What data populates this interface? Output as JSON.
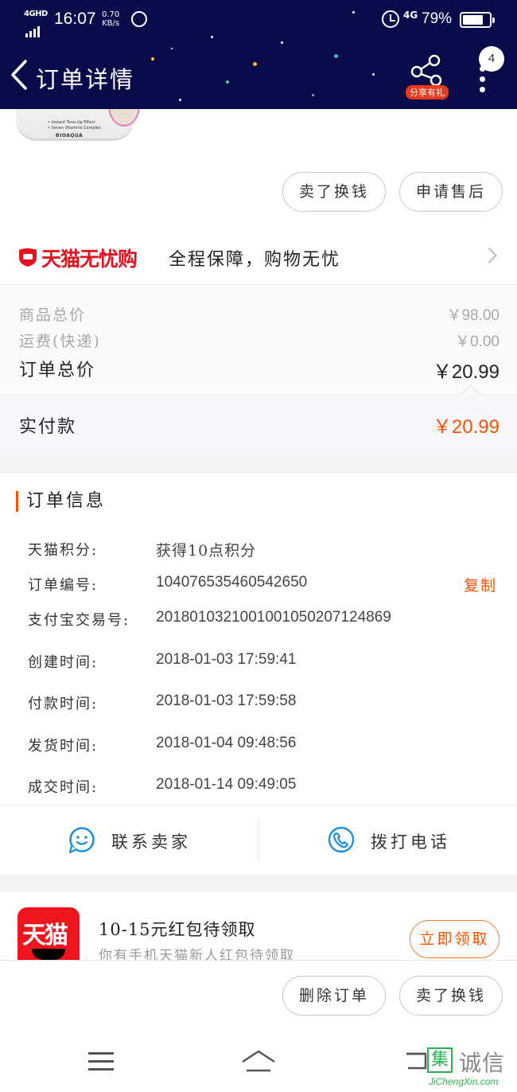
{
  "status_bar": {
    "network": "4GHD",
    "time": "16:07",
    "speed_value": "0.70",
    "speed_unit": "KB/s",
    "network_right": "4G",
    "battery_percent": "79%",
    "battery_level": 0.79
  },
  "nav": {
    "title": "订单详情",
    "share_label": "分享有礼",
    "badge_count": "4"
  },
  "product": {
    "jar_line1": "• Instant Tone-Up Effect",
    "jar_line2": "• Seven Vitamins Complex",
    "jar_brand": "BIOAQUA"
  },
  "actions_top": {
    "sell": "卖了换钱",
    "after_sale": "申请售后"
  },
  "guarantee": {
    "name": "天猫无忧购",
    "slogan": "全程保障，购物无忧"
  },
  "price": {
    "goods_total_label": "商品总价",
    "goods_total_value": "￥98.00",
    "shipping_label": "运费(快递)",
    "shipping_value": "￥0.00",
    "order_total_label": "订单总价",
    "order_total_value": "￥20.99",
    "paid_label": "实付款",
    "paid_value": "￥20.99"
  },
  "order_info": {
    "title": "订单信息",
    "copy_label": "复制",
    "rows": [
      {
        "label": "天猫积分:",
        "value": "获得10点积分"
      },
      {
        "label": "订单编号:",
        "value": "104076535460542650"
      },
      {
        "label": "支付宝交易号:",
        "value": "2018010321001001050207124869"
      },
      {
        "label": "创建时间:",
        "value": "2018-01-03 17:59:41"
      },
      {
        "label": "付款时间:",
        "value": "2018-01-03 17:59:58"
      },
      {
        "label": "发货时间:",
        "value": "2018-01-04 09:48:56"
      },
      {
        "label": "成交时间:",
        "value": "2018-01-14 09:49:05"
      }
    ]
  },
  "contact": {
    "seller": "联系卖家",
    "phone": "拨打电话"
  },
  "promo": {
    "logo_text": "天猫",
    "title": "10-15元红包待领取",
    "subtitle": "你有手机天猫新人红包待领取",
    "button": "立即领取"
  },
  "bottom_actions": {
    "delete": "删除订单",
    "sell": "卖了换钱"
  },
  "watermark": {
    "box_char": "集",
    "text": "诚信",
    "url": "JiChengXin.com"
  },
  "colors": {
    "header_bg": "#0a0b4a",
    "accent": "#ff5000",
    "tmall_red": "#e8101f",
    "link_blue": "#1a8fe0"
  }
}
